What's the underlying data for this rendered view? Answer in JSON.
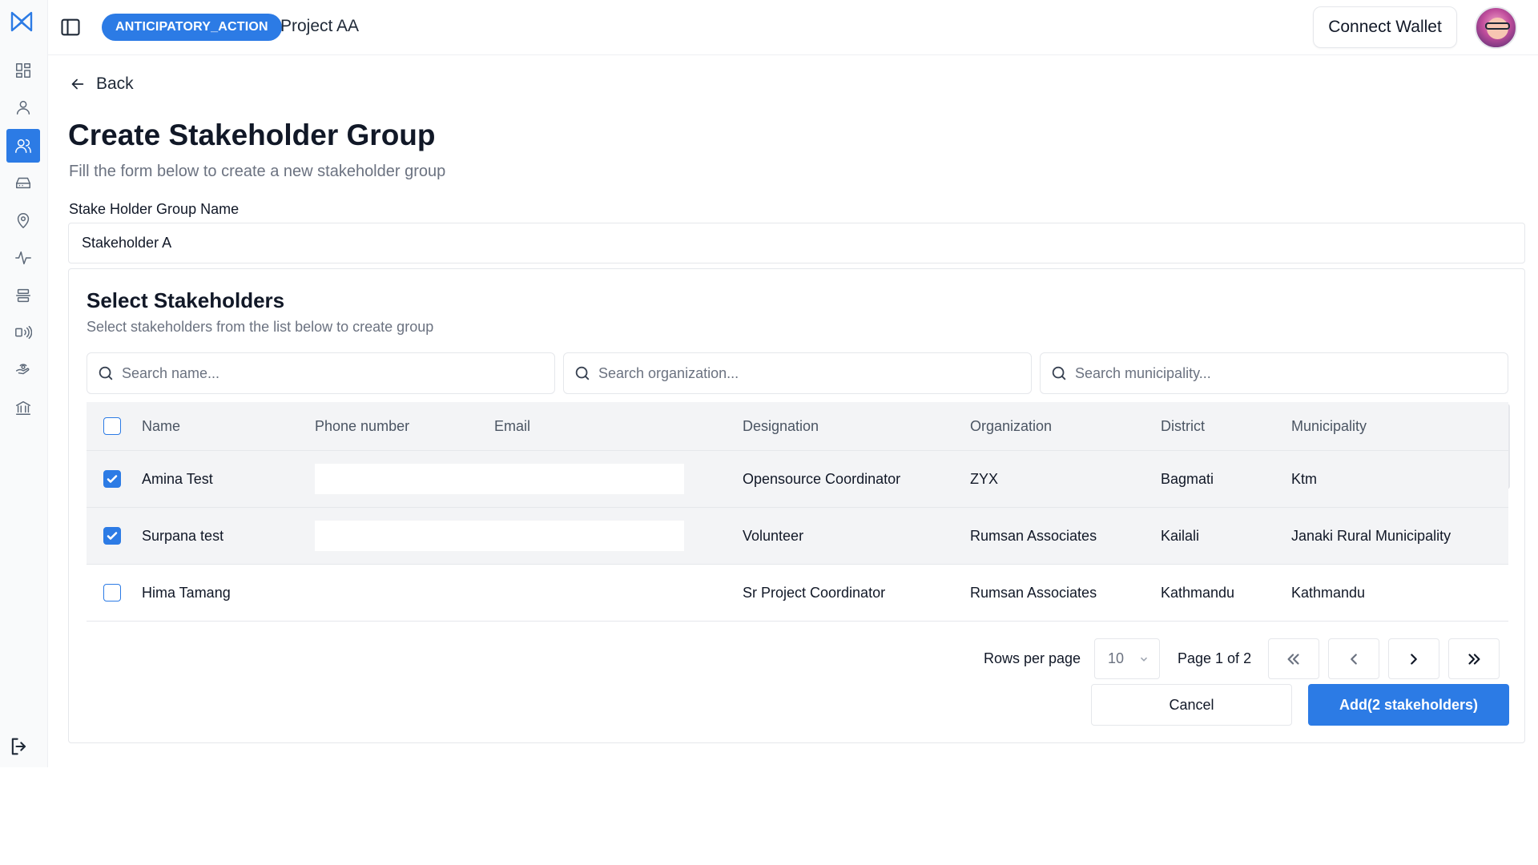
{
  "topbar": {
    "project_badge": "ANTICIPATORY_ACTION",
    "project_name": "Project AA",
    "connect_wallet": "Connect Wallet"
  },
  "sidebar": {
    "items": [
      {
        "icon": "dashboard-icon"
      },
      {
        "icon": "user-icon"
      },
      {
        "icon": "users-icon",
        "active": true
      },
      {
        "icon": "inbox-icon"
      },
      {
        "icon": "location-icon"
      },
      {
        "icon": "activity-icon"
      },
      {
        "icon": "stack-icon"
      },
      {
        "icon": "broadcast-icon"
      },
      {
        "icon": "payment-icon"
      },
      {
        "icon": "bank-icon"
      }
    ],
    "accent": "#2c7be5"
  },
  "back_label": "Back",
  "page": {
    "title": "Create Stakeholder Group",
    "subtitle": "Fill the form below to create a new stakeholder group"
  },
  "form": {
    "group_name_label": "Stake Holder Group Name",
    "group_name_value": "Stakeholder A"
  },
  "select_card": {
    "title": "Select Stakeholders",
    "subtitle": "Select stakeholders from the list below to create group",
    "search_name_placeholder": "Search name...",
    "search_org_placeholder": "Search organization...",
    "search_muni_placeholder": "Search municipality..."
  },
  "table": {
    "columns": [
      "Name",
      "Phone number",
      "Email",
      "Designation",
      "Organization",
      "District",
      "Municipality"
    ],
    "rows": [
      {
        "checked": true,
        "name": "Amina Test",
        "phone": "",
        "email": "",
        "designation": "Opensource Coordinator",
        "organization": "ZYX",
        "district": "Bagmati",
        "municipality": "Ktm"
      },
      {
        "checked": true,
        "name": "Surpana test",
        "phone": "",
        "email": "",
        "designation": "Volunteer",
        "organization": "Rumsan Associates",
        "district": "Kailali",
        "municipality": "Janaki Rural Municipality"
      },
      {
        "checked": false,
        "name": "Hima Tamang",
        "phone": "",
        "email": "",
        "designation": "Sr Project Coordinator",
        "organization": "Rumsan Associates",
        "district": "Kathmandu",
        "municipality": "Kathmandu"
      }
    ]
  },
  "pagination": {
    "rows_per_page_label": "Rows per page",
    "rows_per_page_value": "10",
    "page_info": "Page 1 of 2"
  },
  "actions": {
    "cancel": "Cancel",
    "add": "Add(2 stakeholders)"
  }
}
